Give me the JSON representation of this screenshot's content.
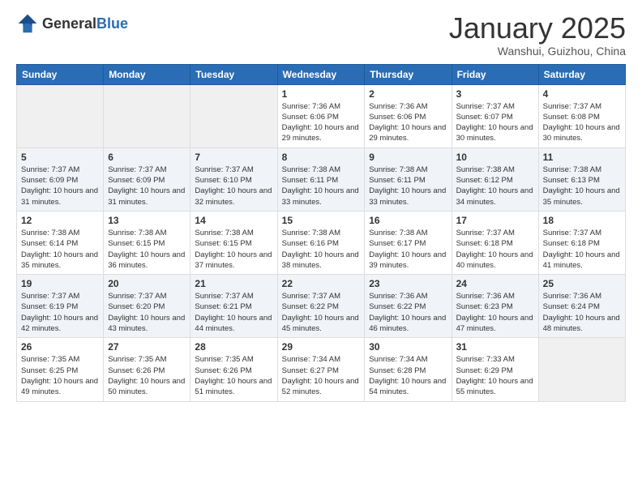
{
  "header": {
    "logo_general": "General",
    "logo_blue": "Blue",
    "month_title": "January 2025",
    "location": "Wanshui, Guizhou, China"
  },
  "days_of_week": [
    "Sunday",
    "Monday",
    "Tuesday",
    "Wednesday",
    "Thursday",
    "Friday",
    "Saturday"
  ],
  "weeks": [
    [
      {
        "day": "",
        "empty": true
      },
      {
        "day": "",
        "empty": true
      },
      {
        "day": "",
        "empty": true
      },
      {
        "day": "1",
        "sunrise": "7:36 AM",
        "sunset": "6:06 PM",
        "daylight": "10 hours and 29 minutes."
      },
      {
        "day": "2",
        "sunrise": "7:36 AM",
        "sunset": "6:06 PM",
        "daylight": "10 hours and 29 minutes."
      },
      {
        "day": "3",
        "sunrise": "7:37 AM",
        "sunset": "6:07 PM",
        "daylight": "10 hours and 30 minutes."
      },
      {
        "day": "4",
        "sunrise": "7:37 AM",
        "sunset": "6:08 PM",
        "daylight": "10 hours and 30 minutes."
      }
    ],
    [
      {
        "day": "5",
        "sunrise": "7:37 AM",
        "sunset": "6:09 PM",
        "daylight": "10 hours and 31 minutes."
      },
      {
        "day": "6",
        "sunrise": "7:37 AM",
        "sunset": "6:09 PM",
        "daylight": "10 hours and 31 minutes."
      },
      {
        "day": "7",
        "sunrise": "7:37 AM",
        "sunset": "6:10 PM",
        "daylight": "10 hours and 32 minutes."
      },
      {
        "day": "8",
        "sunrise": "7:38 AM",
        "sunset": "6:11 PM",
        "daylight": "10 hours and 33 minutes."
      },
      {
        "day": "9",
        "sunrise": "7:38 AM",
        "sunset": "6:11 PM",
        "daylight": "10 hours and 33 minutes."
      },
      {
        "day": "10",
        "sunrise": "7:38 AM",
        "sunset": "6:12 PM",
        "daylight": "10 hours and 34 minutes."
      },
      {
        "day": "11",
        "sunrise": "7:38 AM",
        "sunset": "6:13 PM",
        "daylight": "10 hours and 35 minutes."
      }
    ],
    [
      {
        "day": "12",
        "sunrise": "7:38 AM",
        "sunset": "6:14 PM",
        "daylight": "10 hours and 35 minutes."
      },
      {
        "day": "13",
        "sunrise": "7:38 AM",
        "sunset": "6:15 PM",
        "daylight": "10 hours and 36 minutes."
      },
      {
        "day": "14",
        "sunrise": "7:38 AM",
        "sunset": "6:15 PM",
        "daylight": "10 hours and 37 minutes."
      },
      {
        "day": "15",
        "sunrise": "7:38 AM",
        "sunset": "6:16 PM",
        "daylight": "10 hours and 38 minutes."
      },
      {
        "day": "16",
        "sunrise": "7:38 AM",
        "sunset": "6:17 PM",
        "daylight": "10 hours and 39 minutes."
      },
      {
        "day": "17",
        "sunrise": "7:37 AM",
        "sunset": "6:18 PM",
        "daylight": "10 hours and 40 minutes."
      },
      {
        "day": "18",
        "sunrise": "7:37 AM",
        "sunset": "6:18 PM",
        "daylight": "10 hours and 41 minutes."
      }
    ],
    [
      {
        "day": "19",
        "sunrise": "7:37 AM",
        "sunset": "6:19 PM",
        "daylight": "10 hours and 42 minutes."
      },
      {
        "day": "20",
        "sunrise": "7:37 AM",
        "sunset": "6:20 PM",
        "daylight": "10 hours and 43 minutes."
      },
      {
        "day": "21",
        "sunrise": "7:37 AM",
        "sunset": "6:21 PM",
        "daylight": "10 hours and 44 minutes."
      },
      {
        "day": "22",
        "sunrise": "7:37 AM",
        "sunset": "6:22 PM",
        "daylight": "10 hours and 45 minutes."
      },
      {
        "day": "23",
        "sunrise": "7:36 AM",
        "sunset": "6:22 PM",
        "daylight": "10 hours and 46 minutes."
      },
      {
        "day": "24",
        "sunrise": "7:36 AM",
        "sunset": "6:23 PM",
        "daylight": "10 hours and 47 minutes."
      },
      {
        "day": "25",
        "sunrise": "7:36 AM",
        "sunset": "6:24 PM",
        "daylight": "10 hours and 48 minutes."
      }
    ],
    [
      {
        "day": "26",
        "sunrise": "7:35 AM",
        "sunset": "6:25 PM",
        "daylight": "10 hours and 49 minutes."
      },
      {
        "day": "27",
        "sunrise": "7:35 AM",
        "sunset": "6:26 PM",
        "daylight": "10 hours and 50 minutes."
      },
      {
        "day": "28",
        "sunrise": "7:35 AM",
        "sunset": "6:26 PM",
        "daylight": "10 hours and 51 minutes."
      },
      {
        "day": "29",
        "sunrise": "7:34 AM",
        "sunset": "6:27 PM",
        "daylight": "10 hours and 52 minutes."
      },
      {
        "day": "30",
        "sunrise": "7:34 AM",
        "sunset": "6:28 PM",
        "daylight": "10 hours and 54 minutes."
      },
      {
        "day": "31",
        "sunrise": "7:33 AM",
        "sunset": "6:29 PM",
        "daylight": "10 hours and 55 minutes."
      },
      {
        "day": "",
        "empty": true
      }
    ]
  ]
}
